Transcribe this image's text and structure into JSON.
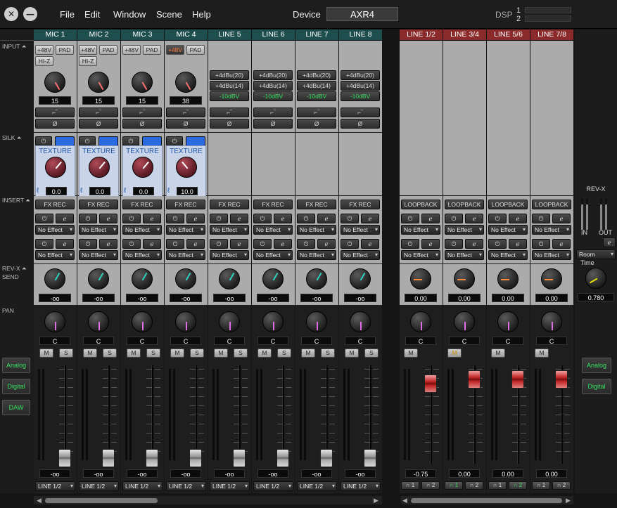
{
  "app": {
    "menus": [
      "File",
      "Edit",
      "Window",
      "Scene",
      "Help"
    ],
    "device_label": "Device",
    "device_value": "AXR4",
    "dsp_label": "DSP",
    "dsp_1": "1",
    "dsp_2": "2",
    "close": "✕",
    "minimize": "—"
  },
  "sections": {
    "input": "INPUT",
    "silk": "SILK",
    "insert": "INSERT",
    "revx_send_1": "REV-X",
    "revx_send_2": "SEND",
    "pan": "PAN"
  },
  "colors": {
    "mic_header": "#1f4e4f",
    "line_header": "#1f4e4f",
    "return_header": "#8a2a2a"
  },
  "input_channels": [
    {
      "name": "MIC 1",
      "type": "mic",
      "phantom": "+48V",
      "phantom_on": false,
      "pad": "PAD",
      "hiz": "HI-Z",
      "gain": "15",
      "silk_label": "TEXTURE",
      "silk_value": "0.0",
      "insert": "FX REC",
      "fx1": "No Effect",
      "fx2": "No Effect",
      "send": "-oo",
      "pan": "C",
      "mute": "M",
      "solo": "S",
      "fader_value": "-oo",
      "output": "LINE 1/2"
    },
    {
      "name": "MIC 2",
      "type": "mic",
      "phantom": "+48V",
      "phantom_on": false,
      "pad": "PAD",
      "hiz": "HI-Z",
      "gain": "15",
      "silk_label": "TEXTURE",
      "silk_value": "0.0",
      "insert": "FX REC",
      "fx1": "No Effect",
      "fx2": "No Effect",
      "send": "-oo",
      "pan": "C",
      "mute": "M",
      "solo": "S",
      "fader_value": "-oo",
      "output": "LINE 1/2"
    },
    {
      "name": "MIC 3",
      "type": "mic",
      "phantom": "+48V",
      "phantom_on": false,
      "pad": "PAD",
      "hiz": "",
      "gain": "15",
      "silk_label": "TEXTURE",
      "silk_value": "0.0",
      "insert": "FX REC",
      "fx1": "No Effect",
      "fx2": "No Effect",
      "send": "-oo",
      "pan": "C",
      "mute": "M",
      "solo": "S",
      "fader_value": "-oo",
      "output": "LINE 1/2"
    },
    {
      "name": "MIC 4",
      "type": "mic",
      "phantom": "+48V",
      "phantom_on": true,
      "pad": "PAD",
      "hiz": "",
      "gain": "38",
      "silk_label": "TEXTURE",
      "silk_value": "10.0",
      "insert": "FX REC",
      "fx1": "No Effect",
      "fx2": "No Effect",
      "send": "-oo",
      "pan": "C",
      "mute": "M",
      "solo": "S",
      "fader_value": "-oo",
      "output": "LINE 1/2"
    },
    {
      "name": "LINE 5",
      "type": "line",
      "lvl1": "+4dBu(20)",
      "lvl2": "+4dBu(14)",
      "lvl3": "-10dBV",
      "insert": "FX REC",
      "fx1": "No Effect",
      "fx2": "No Effect",
      "send": "-oo",
      "pan": "C",
      "mute": "M",
      "solo": "S",
      "fader_value": "-oo",
      "output": "LINE 1/2"
    },
    {
      "name": "LINE 6",
      "type": "line",
      "lvl1": "+4dBu(20)",
      "lvl2": "+4dBu(14)",
      "lvl3": "-10dBV",
      "insert": "FX REC",
      "fx1": "No Effect",
      "fx2": "No Effect",
      "send": "-oo",
      "pan": "C",
      "mute": "M",
      "solo": "S",
      "fader_value": "-oo",
      "output": "LINE 1/2"
    },
    {
      "name": "LINE 7",
      "type": "line",
      "lvl1": "+4dBu(20)",
      "lvl2": "+4dBu(14)",
      "lvl3": "-10dBV",
      "insert": "FX REC",
      "fx1": "No Effect",
      "fx2": "No Effect",
      "send": "-oo",
      "pan": "C",
      "mute": "M",
      "solo": "S",
      "fader_value": "-oo",
      "output": "LINE 1/2"
    },
    {
      "name": "LINE 8",
      "type": "line",
      "lvl1": "+4dBu(20)",
      "lvl2": "+4dBu(14)",
      "lvl3": "-10dBV",
      "insert": "FX REC",
      "fx1": "No Effect",
      "fx2": "No Effect",
      "send": "-oo",
      "pan": "C",
      "mute": "M",
      "solo": "S",
      "fader_value": "-oo",
      "output": "LINE 1/2"
    }
  ],
  "return_channels": [
    {
      "name": "LINE 1/2",
      "insert": "LOOPBACK",
      "fx1": "No Effect",
      "fx2": "No Effect",
      "send": "0.00",
      "pan": "C",
      "mute": "M",
      "mute_on": false,
      "fader_value": "-0.75",
      "hp1": "1",
      "hp2": "2",
      "hp1_on": false,
      "hp2_on": false
    },
    {
      "name": "LINE 3/4",
      "insert": "LOOPBACK",
      "fx1": "No Effect",
      "fx2": "No Effect",
      "send": "0.00",
      "pan": "C",
      "mute": "M",
      "mute_on": true,
      "fader_value": "0.00",
      "hp1": "1",
      "hp2": "2",
      "hp1_on": true,
      "hp2_on": false
    },
    {
      "name": "LINE 5/6",
      "insert": "LOOPBACK",
      "fx1": "No Effect",
      "fx2": "No Effect",
      "send": "0.00",
      "pan": "C",
      "mute": "M",
      "mute_on": false,
      "fader_value": "0.00",
      "hp1": "1",
      "hp2": "2",
      "hp1_on": false,
      "hp2_on": true
    },
    {
      "name": "LINE 7/8",
      "insert": "LOOPBACK",
      "fx1": "No Effect",
      "fx2": "No Effect",
      "send": "0.00",
      "pan": "C",
      "mute": "M",
      "mute_on": false,
      "fader_value": "0.00",
      "hp1": "1",
      "hp2": "2",
      "hp1_on": false,
      "hp2_on": false
    }
  ],
  "revx": {
    "title": "REV-X",
    "in": "IN",
    "out": "OUT",
    "type": "Room",
    "time_label": "Time",
    "time_value": "0.780"
  },
  "side_left": [
    "Analog",
    "Digital",
    "DAW"
  ],
  "side_right": [
    "Analog",
    "Digital"
  ]
}
